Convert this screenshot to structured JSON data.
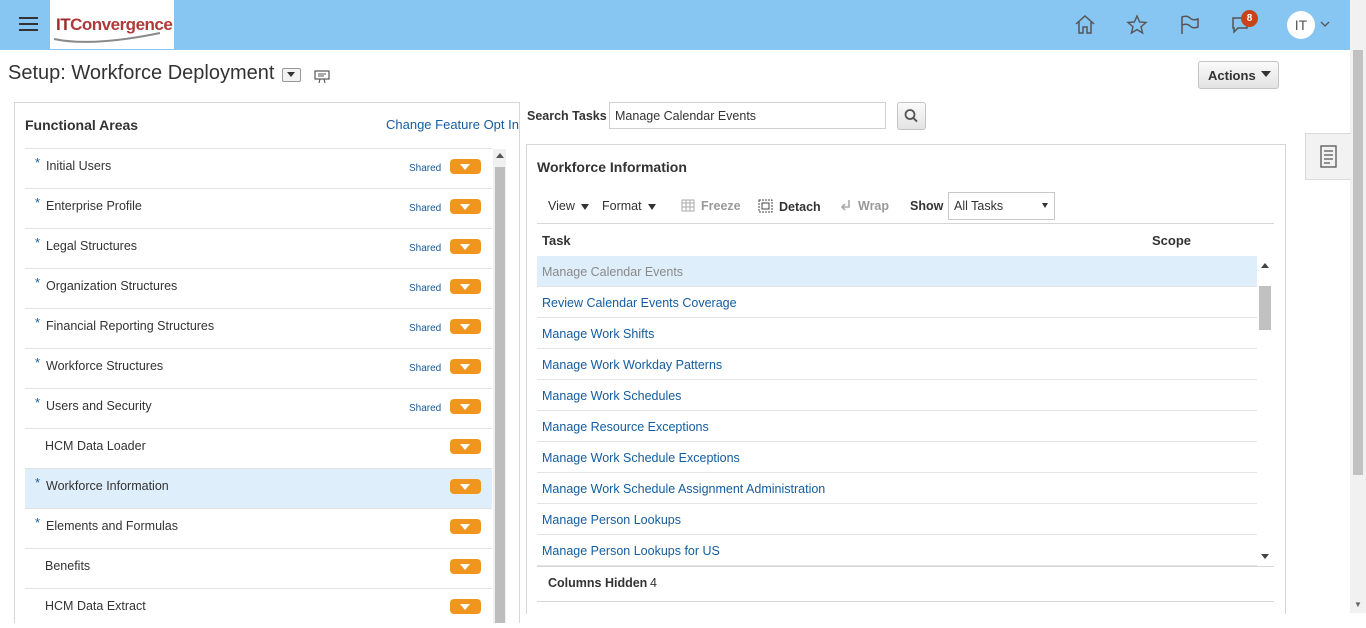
{
  "header": {
    "logo_text_it": "IT",
    "logo_text_conv": "Convergence",
    "notification_count": "8",
    "avatar_initials": "IT",
    "bg_color": "#87c5f2"
  },
  "page": {
    "title": "Setup: Workforce Deployment",
    "actions_label": "Actions"
  },
  "functional_areas": {
    "heading": "Functional Areas",
    "change_link": "Change Feature Opt In",
    "items": [
      {
        "label": "Initial Users",
        "required": true,
        "shared": "Shared"
      },
      {
        "label": "Enterprise Profile",
        "required": true,
        "shared": "Shared"
      },
      {
        "label": "Legal Structures",
        "required": true,
        "shared": "Shared"
      },
      {
        "label": "Organization Structures",
        "required": true,
        "shared": "Shared"
      },
      {
        "label": "Financial Reporting Structures",
        "required": true,
        "shared": "Shared"
      },
      {
        "label": "Workforce Structures",
        "required": true,
        "shared": "Shared"
      },
      {
        "label": "Users and Security",
        "required": true,
        "shared": "Shared"
      },
      {
        "label": "HCM Data Loader",
        "required": false,
        "shared": ""
      },
      {
        "label": "Workforce Information",
        "required": true,
        "shared": "",
        "selected": true
      },
      {
        "label": "Elements and Formulas",
        "required": true,
        "shared": ""
      },
      {
        "label": "Benefits",
        "required": false,
        "shared": ""
      },
      {
        "label": "HCM Data Extract",
        "required": false,
        "shared": ""
      }
    ],
    "required_marker": "*"
  },
  "search": {
    "label": "Search Tasks",
    "value": "Manage Calendar Events"
  },
  "workforce_info": {
    "title": "Workforce Information",
    "toolbar": {
      "view": "View",
      "format": "Format",
      "freeze": "Freeze",
      "detach": "Detach",
      "wrap": "Wrap",
      "show": "Show",
      "show_value": "All Tasks"
    },
    "columns": {
      "task": "Task",
      "scope": "Scope"
    },
    "rows": [
      "Manage Calendar Events",
      "Review Calendar Events Coverage",
      "Manage Work Shifts",
      "Manage Work Workday Patterns",
      "Manage Work Schedules",
      "Manage Resource Exceptions",
      "Manage Work Schedule Exceptions",
      "Manage Work Schedule Assignment Administration",
      "Manage Person Lookups",
      "Manage Person Lookups for US"
    ],
    "columns_hidden_label": "Columns Hidden",
    "columns_hidden_count": "4"
  },
  "colors": {
    "link": "#145c9e",
    "orange_button": "#f0961f",
    "selected_row": "#dfeefb"
  }
}
